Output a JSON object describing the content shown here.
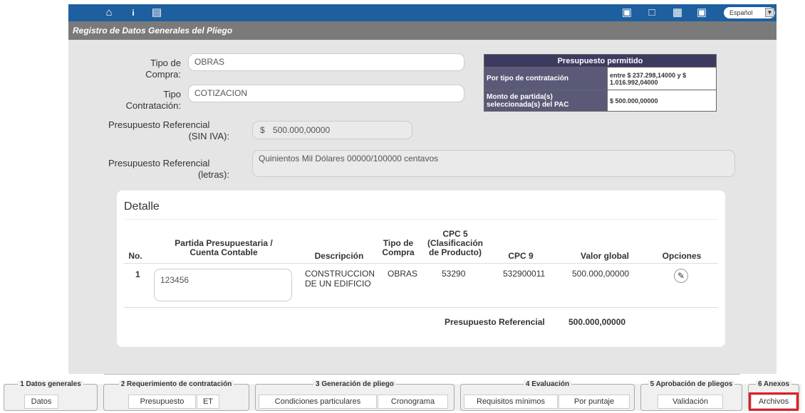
{
  "topbar": {
    "language": "Español"
  },
  "title": "Registro de Datos Generales del Pliego",
  "form": {
    "tipo_compra_label_1": "Tipo de",
    "tipo_compra_label_2": "Compra:",
    "tipo_compra_value": "OBRAS",
    "tipo_contratacion_label_1": "Tipo",
    "tipo_contratacion_label_2": "Contratación:",
    "tipo_contratacion_value": "COTIZACION",
    "presupuesto_label_1": "Presupuesto Referencial",
    "presupuesto_label_2": "(SIN IVA):",
    "currency": "$",
    "presupuesto_value": "500.000,00000",
    "letras_label_1": "Presupuesto Referencial",
    "letras_label_2": "(letras):",
    "letras_value": "Quinientos Mil Dólares 00000/100000 centavos"
  },
  "budget": {
    "header": "Presupuesto permitido",
    "row1_label": "Por tipo de contratación",
    "row1_value": "entre $ 237.298,14000 y $ 1.016.992,04000",
    "row2_label": "Monto de partida(s) seleccionada(s) del PAC",
    "row2_value": "$  500.000,00000"
  },
  "detail": {
    "title": "Detalle",
    "columns": [
      "No.",
      "Partida Presupuestaria / Cuenta Contable",
      "Descripción",
      "Tipo de Compra",
      "CPC 5 (Clasificación de Producto)",
      "CPC 9",
      "Valor global",
      "Opciones"
    ],
    "row": {
      "no": "1",
      "partida": "123456",
      "descripcion": "CONSTRUCCION DE UN EDIFICIO",
      "tipo": "OBRAS",
      "cpc5": "53290",
      "cpc9": "532900011",
      "valor": "500.000,00000"
    },
    "total_label": "Presupuesto Referencial",
    "total_value": "500.000,00000"
  },
  "steps": {
    "s1": "1 Datos generales",
    "s1_b1": "Datos",
    "s2": "2 Requerimiento de contratación",
    "s2_b1": "Presupuesto",
    "s2_b2": "ET",
    "s3": "3 Generación de pliego",
    "s3_b1": "Condiciones particulares",
    "s3_b2": "Cronograma",
    "s4": "4 Evaluación",
    "s4_b1": "Requisitos mínimos",
    "s4_b2": "Por puntaje",
    "s5": "5 Aprobación de pliegos",
    "s5_b1": "Validación",
    "s6": "6 Anexos",
    "s6_b1": "Archivos"
  }
}
